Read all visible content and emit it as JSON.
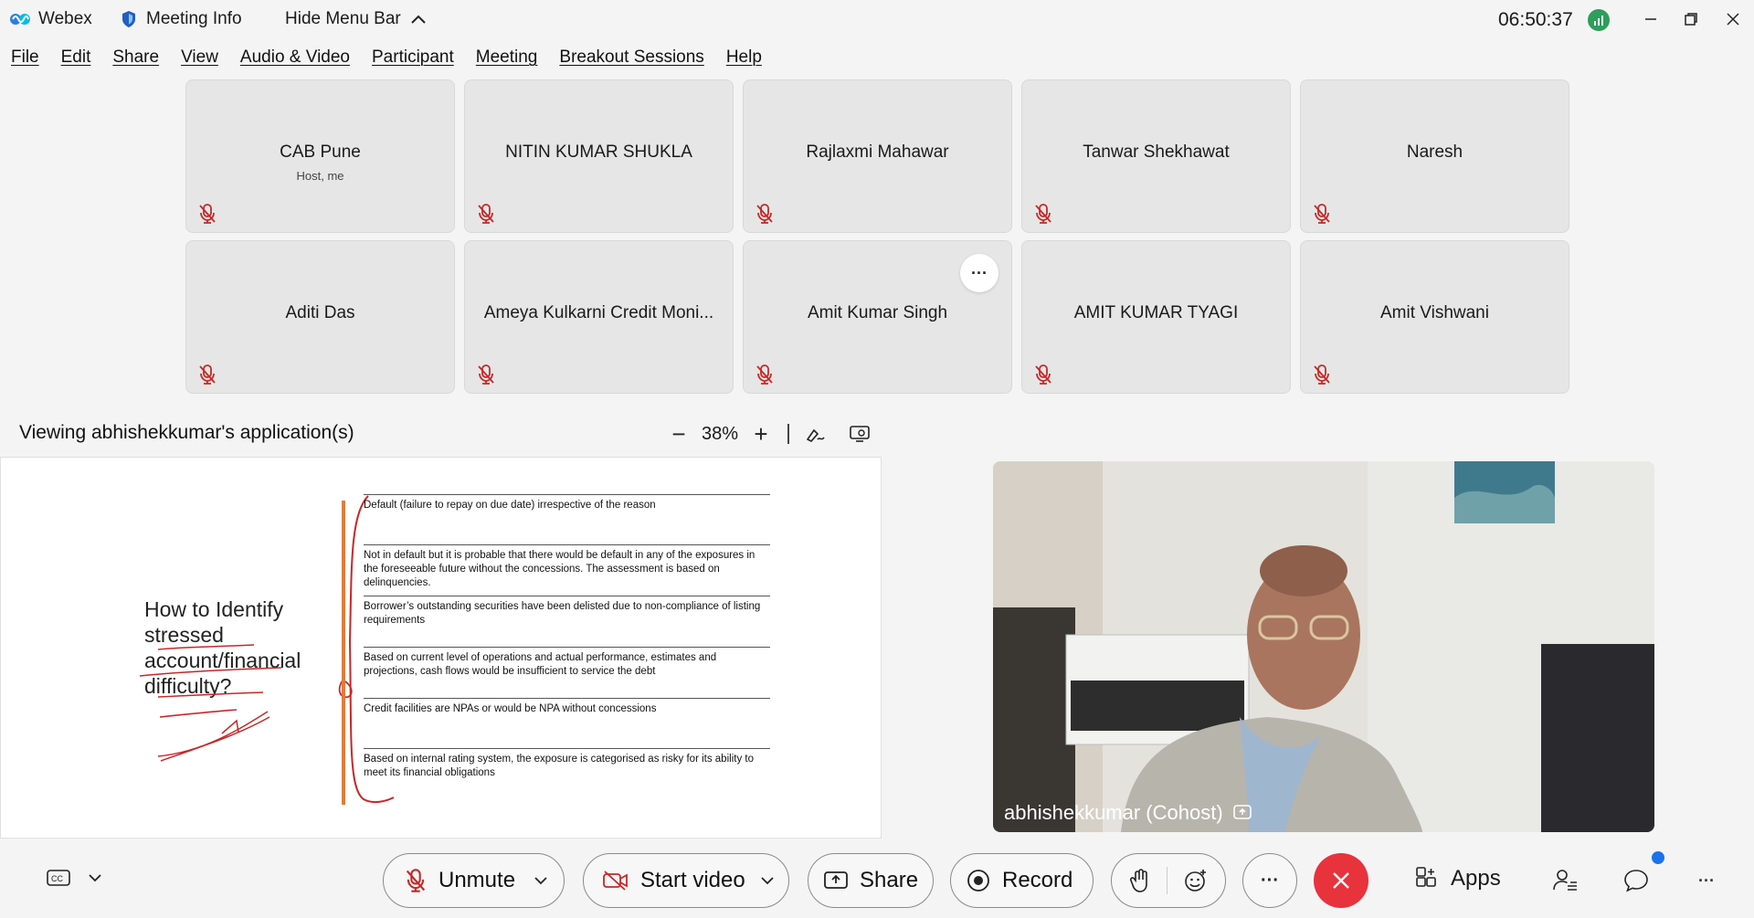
{
  "titlebar": {
    "app_name": "Webex",
    "meeting_info": "Meeting Info",
    "hide_menu": "Hide Menu Bar",
    "clock": "06:50:37"
  },
  "menu": [
    "File",
    "Edit",
    "Share",
    "View",
    "Audio & Video",
    "Participant",
    "Meeting",
    "Breakout Sessions",
    "Help"
  ],
  "participants": [
    {
      "name": "CAB Pune",
      "sub": "Host, me"
    },
    {
      "name": "NITIN KUMAR SHUKLA",
      "sub": ""
    },
    {
      "name": "Rajlaxmi Mahawar",
      "sub": ""
    },
    {
      "name": "Tanwar Shekhawat",
      "sub": ""
    },
    {
      "name": "Naresh",
      "sub": ""
    },
    {
      "name": "Aditi Das",
      "sub": ""
    },
    {
      "name": "Ameya Kulkarni Credit Moni...",
      "sub": ""
    },
    {
      "name": "Amit Kumar Singh",
      "sub": "",
      "more": "···"
    },
    {
      "name": "AMIT KUMAR TYAGI",
      "sub": ""
    },
    {
      "name": "Amit Vishwani",
      "sub": ""
    }
  ],
  "share": {
    "viewing_label": "Viewing abhishekkumar's application(s)",
    "zoom": "38%",
    "zoom_minus": "−",
    "zoom_plus": "+"
  },
  "slide": {
    "title_lines": [
      "How to Identify",
      "stressed",
      "account/financial",
      "difficulty?"
    ],
    "rows": [
      "Default (failure to repay on due date) irrespective of the reason",
      "Not in default but it is probable that there would be default in any of the exposures in the foreseeable future without the concessions. The assessment is based on delinquencies.",
      "Borrower’s outstanding securities have been delisted due to non-compliance of listing requirements",
      "Based on current level of operations and actual performance, estimates and projections, cash flows would be insufficient to service the debt",
      "Credit facilities are NPAs or would be NPA without concessions",
      "Based on internal rating system, the exposure is categorised as risky for its ability to meet its financial obligations"
    ]
  },
  "video": {
    "label": "abhishekkumar (Cohost)"
  },
  "controls": {
    "unmute": "Unmute",
    "start_video": "Start video",
    "share": "Share",
    "record": "Record",
    "more": "···",
    "apps": "Apps",
    "overflow": "···"
  },
  "colors": {
    "end_call": "#e8323c",
    "accent": "#1a73e8",
    "mute_red": "#d32f2f",
    "slide_bar": "#e07b39"
  }
}
